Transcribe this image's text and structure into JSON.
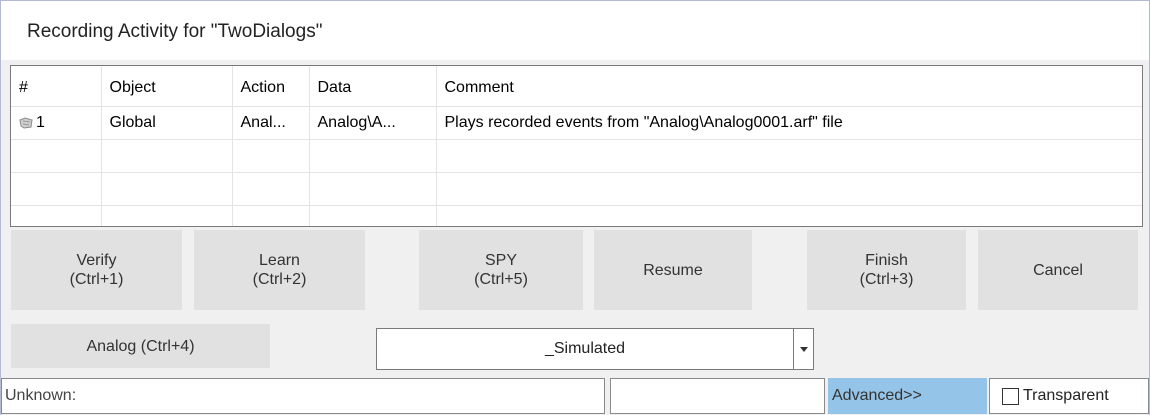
{
  "window": {
    "title": "Recording Activity for \"TwoDialogs\""
  },
  "grid": {
    "columns": [
      "#",
      "Object",
      "Action",
      "Data",
      "Comment"
    ],
    "rows": [
      {
        "num": "1",
        "object": "Global",
        "action": "Anal...",
        "data": "Analog\\A...",
        "comment": "Plays recorded events from \"Analog\\Analog0001.arf\" file",
        "icon": "recording-icon"
      }
    ]
  },
  "buttons": {
    "verify": {
      "line1": "Verify",
      "line2": "(Ctrl+1)"
    },
    "learn": {
      "line1": "Learn",
      "line2": "(Ctrl+2)"
    },
    "spy": {
      "line1": "SPY",
      "line2": "(Ctrl+5)"
    },
    "resume": {
      "line1": "Resume"
    },
    "finish": {
      "line1": "Finish",
      "line2": "(Ctrl+3)"
    },
    "cancel": {
      "line1": "Cancel"
    },
    "analog": {
      "line1": "Analog (Ctrl+4)"
    }
  },
  "combo": {
    "value": "_Simulated",
    "arrow_icon": "chevron-down-icon"
  },
  "status": {
    "field1": "Unknown:",
    "field2": "",
    "advanced": "Advanced>>",
    "transparent_label": "Transparent",
    "transparent_checked": false
  },
  "colors": {
    "button_bg": "#e1e1e1",
    "advanced_bg": "#94c4e8",
    "window_bg": "#f0f0f0"
  }
}
